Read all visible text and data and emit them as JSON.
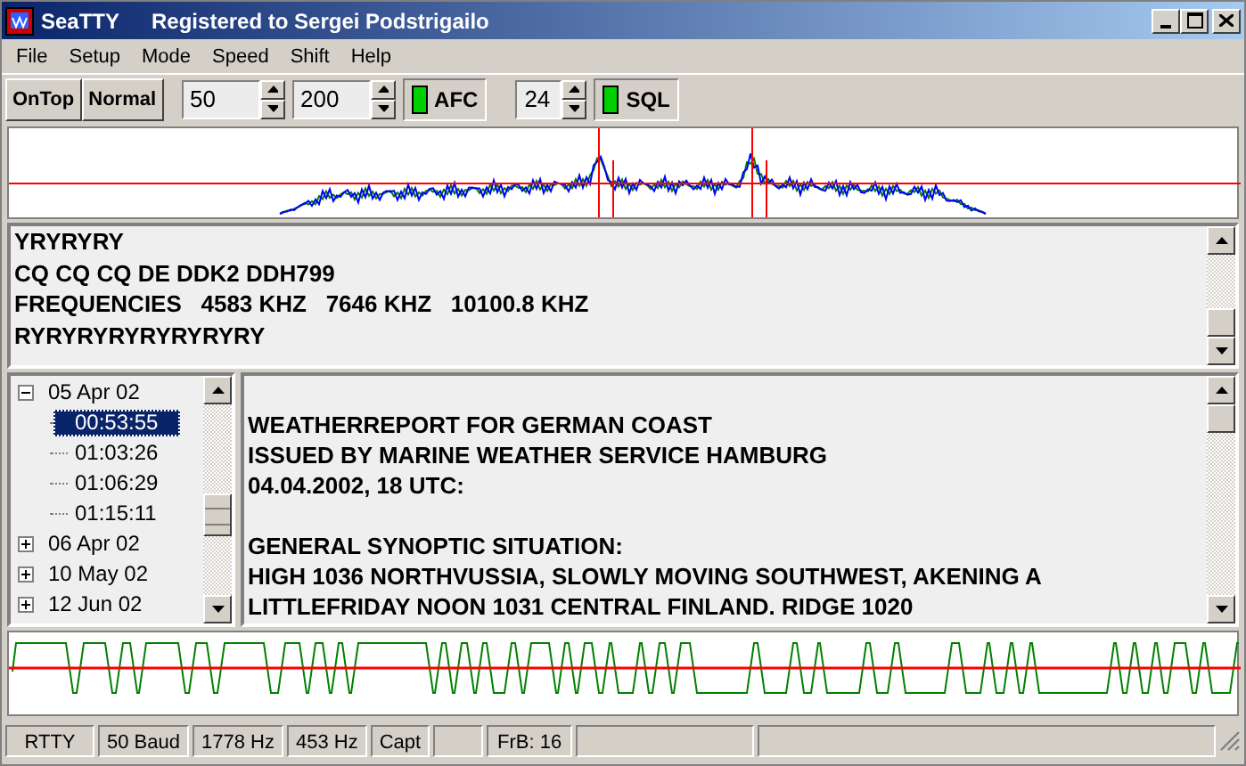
{
  "window": {
    "title": "SeaTTY",
    "subtitle": "Registered to Sergei Podstrigailo"
  },
  "menu": [
    "File",
    "Setup",
    "Mode",
    "Speed",
    "Shift",
    "Help"
  ],
  "toolbar": [
    {
      "kind": "button",
      "label": "OnTop"
    },
    {
      "kind": "button",
      "label": "Normal"
    },
    {
      "kind": "spin",
      "value": "50"
    },
    {
      "kind": "spin",
      "value": "200"
    },
    {
      "kind": "led",
      "label": "AFC",
      "on": true
    },
    {
      "kind": "spin",
      "value": "24"
    },
    {
      "kind": "led",
      "label": "SQL",
      "on": true
    }
  ],
  "receive_text": [
    "YRYRYRY",
    "CQ CQ CQ DE DDK2 DDH799",
    "FREQUENCIES   4583 KHZ   7646 KHZ   10100.8 KHZ",
    "RYRYRYRYRYRYRYRY"
  ],
  "tree": [
    {
      "label": "05 Apr 02",
      "expanded": true,
      "children": [
        {
          "label": "00:53:55",
          "selected": true
        },
        {
          "label": "01:03:26",
          "selected": false
        },
        {
          "label": "01:06:29",
          "selected": false
        },
        {
          "label": "01:15:11",
          "selected": false
        }
      ]
    },
    {
      "label": "06 Apr 02",
      "expanded": false
    },
    {
      "label": "10 May 02",
      "expanded": false
    },
    {
      "label": "12 Jun 02",
      "expanded": false
    }
  ],
  "message": [
    [
      "WEATHERREPORT FOR GERMAN COAST",
      "ISSUED BY MARINE WEATHER SERVICE HAMBURG",
      "04.04.2002, 18 UTC:"
    ],
    [
      "GENERAL SYNOPTIC SITUATION:",
      "HIGH 1036 NORTHVUSSIA, SLOWLY MOVING SOUTHWEST, AKENING A",
      "LITTLEFRIDAY NOON 1031 CENTRAL FINLAND. RIDGE 1020"
    ]
  ],
  "status_bar": [
    {
      "kind": "text",
      "text": "RTTY"
    },
    {
      "kind": "text",
      "text": "50 Baud"
    },
    {
      "kind": "text",
      "text": "1778 Hz"
    },
    {
      "kind": "text",
      "text": "453 Hz"
    },
    {
      "kind": "text",
      "text": "Capt"
    },
    {
      "kind": "empty"
    },
    {
      "kind": "text",
      "text": "FrB: 16"
    },
    {
      "kind": "empty"
    },
    {
      "kind": "empty"
    }
  ]
}
